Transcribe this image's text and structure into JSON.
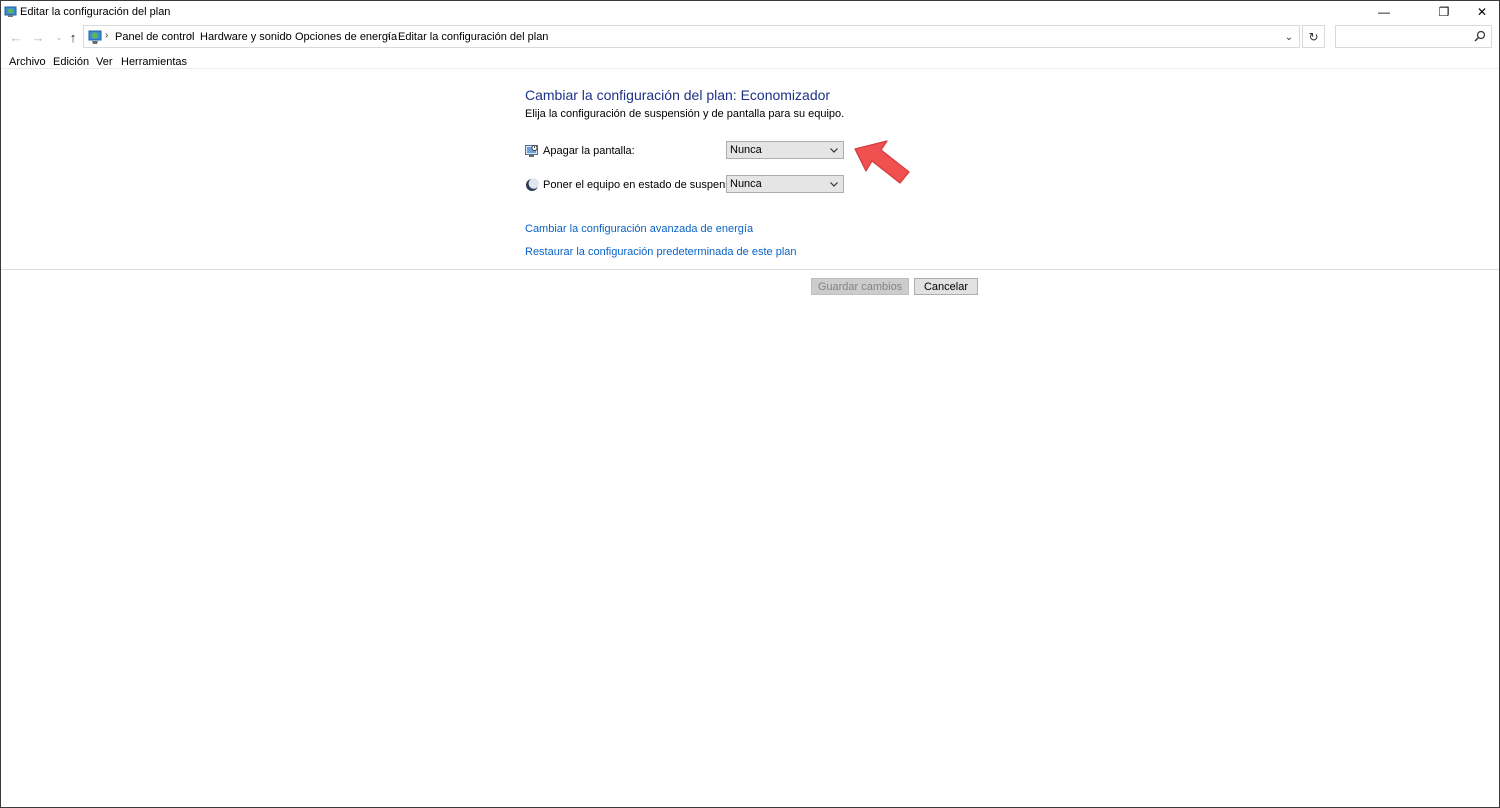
{
  "window": {
    "title": "Editar la configuración del plan",
    "controls": {
      "minimize": "—",
      "maximize": "❐",
      "close": "✕"
    }
  },
  "navigation": {
    "back": "←",
    "forward": "→",
    "recent": "⌄",
    "up": "↑",
    "breadcrumbs": [
      "Panel de control",
      "Hardware y sonido",
      "Opciones de energía",
      "Editar la configuración del plan"
    ],
    "separator": "›",
    "dropdown": "⌄",
    "refresh": "↻",
    "search_placeholder": ""
  },
  "menu": [
    "Archivo",
    "Edición",
    "Ver",
    "Herramientas"
  ],
  "content": {
    "heading": "Cambiar la configuración del plan: Economizador",
    "subheading": "Elija la configuración de suspensión y de pantalla para su equipo.",
    "settings": [
      {
        "label": "Apagar la pantalla:",
        "value": "Nunca",
        "icon": "monitor-icon"
      },
      {
        "label": "Poner el equipo en estado de suspensión:",
        "value": "Nunca",
        "icon": "moon-icon"
      }
    ],
    "links": [
      "Cambiar la configuración avanzada de energía",
      "Restaurar la configuración predeterminada de este plan"
    ]
  },
  "buttons": {
    "save": "Guardar cambios",
    "cancel": "Cancelar"
  },
  "colors": {
    "heading": "#1e3287",
    "link": "#0b63c6",
    "annotation_arrow": "#f0504f"
  }
}
